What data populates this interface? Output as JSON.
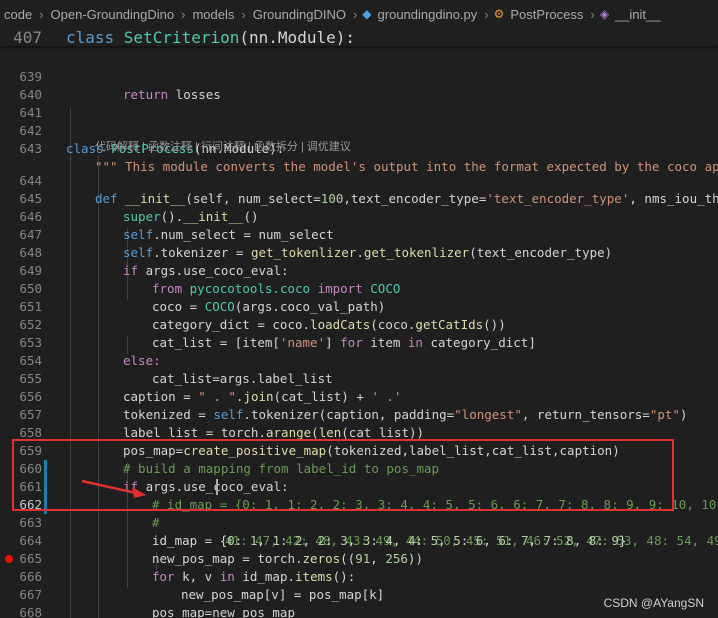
{
  "breadcrumb": {
    "items": [
      "code",
      "Open-GroundingDino",
      "models",
      "GroundingDINO",
      "groundingdino.py",
      "PostProcess",
      "__init__"
    ]
  },
  "sticky": {
    "line": "407",
    "text_kw": "class ",
    "text_cls": "SetCriterion",
    "text_rest": "(nn.Module):"
  },
  "codelens": "代码解释 | 函数注释 | 行间注释 | 函数拆分 | 调优建议",
  "lines": {
    "l639": {
      "n": "639",
      "a": "return",
      "b": " losses"
    },
    "l640": {
      "n": "640"
    },
    "l641": {
      "n": "641"
    },
    "l642": {
      "n": "642",
      "a": "class ",
      "b": "PostProcess",
      "c": "(nn.Module):"
    },
    "l643": {
      "n": "643",
      "a": "\"\"\" This module converts the model's output into the format expected by the coco api\"\"\""
    },
    "l644": {
      "n": "644",
      "a": "def ",
      "b": "__init__",
      "c": "(self, num_select=",
      "d": "100",
      "e": ",text_encoder_type=",
      "f": "'text_encoder_type'",
      "g": ", nms_iou_thresh"
    },
    "l645": {
      "n": "645",
      "a": "super",
      "b": "().",
      "c": "__init__",
      "d": "()"
    },
    "l646": {
      "n": "646",
      "a": "self",
      "b": ".num_select = num_select"
    },
    "l647": {
      "n": "647",
      "a": "self",
      "b": ".tokenizer = ",
      "c": "get_tokenlizer",
      "d": ".",
      "e": "get_tokenlizer",
      "f": "(text_encoder_type)"
    },
    "l648": {
      "n": "648",
      "a": "if ",
      "b": "args.use_coco_eval:"
    },
    "l649": {
      "n": "649",
      "a": "from ",
      "b": "pycocotools.coco ",
      "c": "import ",
      "d": "COCO"
    },
    "l650": {
      "n": "650",
      "a": "coco = ",
      "b": "COCO",
      "c": "(args.coco_val_path)"
    },
    "l651": {
      "n": "651",
      "a": "category_dict = coco.",
      "b": "loadCats",
      "c": "(coco.",
      "d": "getCatIds",
      "e": "())"
    },
    "l652": {
      "n": "652",
      "a": "cat_list = [item[",
      "b": "'name'",
      "c": "] ",
      "d": "for ",
      "e": "item ",
      "f": "in ",
      "g": "category_dict]"
    },
    "l653": {
      "n": "653",
      "a": "else:"
    },
    "l654": {
      "n": "654",
      "a": "cat_list=args.label_list"
    },
    "l655": {
      "n": "655",
      "a": "caption = ",
      "b": "\" . \"",
      "c": ".",
      "d": "join",
      "e": "(cat_list) + ",
      "f": "' .'"
    },
    "l656": {
      "n": "656",
      "a": "tokenized = ",
      "b": "self",
      "c": ".tokenizer(caption, padding=",
      "d": "\"longest\"",
      "e": ", return_tensors=",
      "f": "\"pt\"",
      "g": ")"
    },
    "l657": {
      "n": "657",
      "a": "label_list = torch.",
      "b": "arange",
      "c": "(",
      "d": "len",
      "e": "(cat_list))"
    },
    "l658": {
      "n": "658",
      "a": "pos_map=",
      "b": "create_positive_map",
      "c": "(tokenized,label_list,cat_list,caption)"
    },
    "l659": {
      "n": "659",
      "a": "# build a mapping from label_id to pos_map"
    },
    "l660": {
      "n": "660",
      "a": "if ",
      "b": "args.use_coco_eval:"
    },
    "l661": {
      "n": "661",
      "a": "# id_map = {0: 1, 1: 2, 2: 3, 3: 4, 4: 5, 5: 6, 6: 7, 7: 8, 8: 9, 9: 10, 10: 11"
    },
    "l662": {
      "n": "662",
      "a": "#",
      "b": "41: 47, 42: 48, 43: 49, 44: 50, 45: 51, 46: 52, 47: 53, 48: 54, 49: 5"
    },
    "l663": {
      "n": "663",
      "a": "id_map = {",
      "b": "0",
      "c": ": ",
      "d": "1",
      "e": ", ",
      "f": "1",
      "g": ": ",
      "h": "2",
      "i": ", ",
      "j": "2",
      "k": ": ",
      "l": "3",
      "m": ", ",
      "o": "3",
      "p": ": ",
      "q": "4",
      "r": ", ",
      "s": "4",
      "t": ": ",
      "u": "5",
      "v": ", ",
      "w": "5",
      "x": ": ",
      "y": "6",
      "z": ", ",
      "a2": "6",
      "b2": ": ",
      "c2": "7",
      "d2": ", ",
      "e2": "7",
      "f2": ": ",
      "g2": "8",
      "h2": ", ",
      "i2": "8",
      "j2": ": ",
      "k2": "9",
      "l2": "}"
    },
    "l664": {
      "n": "664",
      "a": "new_pos_map = torch.",
      "b": "zeros",
      "c": "((",
      "d": "91",
      "e": ", ",
      "f": "256",
      "g": "))"
    },
    "l665": {
      "n": "665",
      "a": "for ",
      "b": "k, v ",
      "c": "in ",
      "d": "id_map.",
      "e": "items",
      "f": "():"
    },
    "l666": {
      "n": "666",
      "a": "new_pos_map[v] = pos_map[k]"
    },
    "l667": {
      "n": "667",
      "a": "pos_map=new_pos_map"
    },
    "l668": {
      "n": "668"
    },
    "l669": {
      "n": "669"
    }
  },
  "watermark": "CSDN @AYangSN",
  "colors": {
    "highlight_box": "#e03131",
    "keyword": "#569cd6",
    "string": "#ce9178",
    "comment": "#6a9955",
    "breakpoint": "#e51400"
  }
}
